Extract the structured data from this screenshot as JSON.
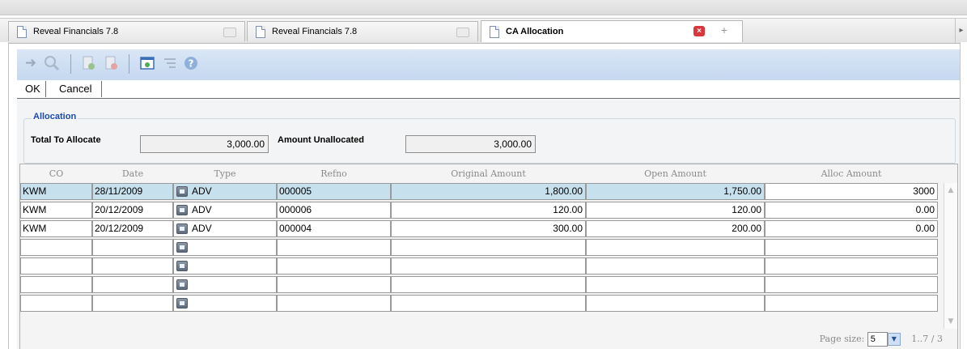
{
  "tabs": [
    {
      "label": "Reveal Financials 7.8",
      "active": false
    },
    {
      "label": "Reveal Financials 7.8",
      "active": false
    },
    {
      "label": "CA Allocation",
      "active": true
    }
  ],
  "toolbar": {
    "icons": [
      "back-icon",
      "search-icon",
      "add-record-icon",
      "delete-record-icon",
      "new-window-icon",
      "filter-icon",
      "help-icon"
    ]
  },
  "buttons": {
    "ok": "OK",
    "cancel": "Cancel"
  },
  "allocation": {
    "legend": "Allocation",
    "total_label": "Total To Allocate",
    "total_value": "3,000.00",
    "unallocated_label": "Amount Unallocated",
    "unallocated_value": "3,000.00"
  },
  "grid": {
    "columns": [
      "CO",
      "Date",
      "Type",
      "Refno",
      "Original Amount",
      "Open Amount",
      "Alloc Amount"
    ],
    "rows": [
      {
        "co": "KWM",
        "date": "28/11/2009",
        "type": "ADV",
        "refno": "000005",
        "original": "1,800.00",
        "open": "1,750.00",
        "alloc": "3000"
      },
      {
        "co": "KWM",
        "date": "20/12/2009",
        "type": "ADV",
        "refno": "000006",
        "original": "120.00",
        "open": "120.00",
        "alloc": "0.00"
      },
      {
        "co": "KWM",
        "date": "20/12/2009",
        "type": "ADV",
        "refno": "000004",
        "original": "300.00",
        "open": "200.00",
        "alloc": "0.00"
      },
      {
        "co": "",
        "date": "",
        "type": "",
        "refno": "",
        "original": "",
        "open": "",
        "alloc": ""
      },
      {
        "co": "",
        "date": "",
        "type": "",
        "refno": "",
        "original": "",
        "open": "",
        "alloc": ""
      },
      {
        "co": "",
        "date": "",
        "type": "",
        "refno": "",
        "original": "",
        "open": "",
        "alloc": ""
      },
      {
        "co": "",
        "date": "",
        "type": "",
        "refno": "",
        "original": "",
        "open": "",
        "alloc": ""
      }
    ]
  },
  "pager": {
    "page_size_label": "Page size:",
    "page_size": "5",
    "range": "1..7 / 3"
  }
}
